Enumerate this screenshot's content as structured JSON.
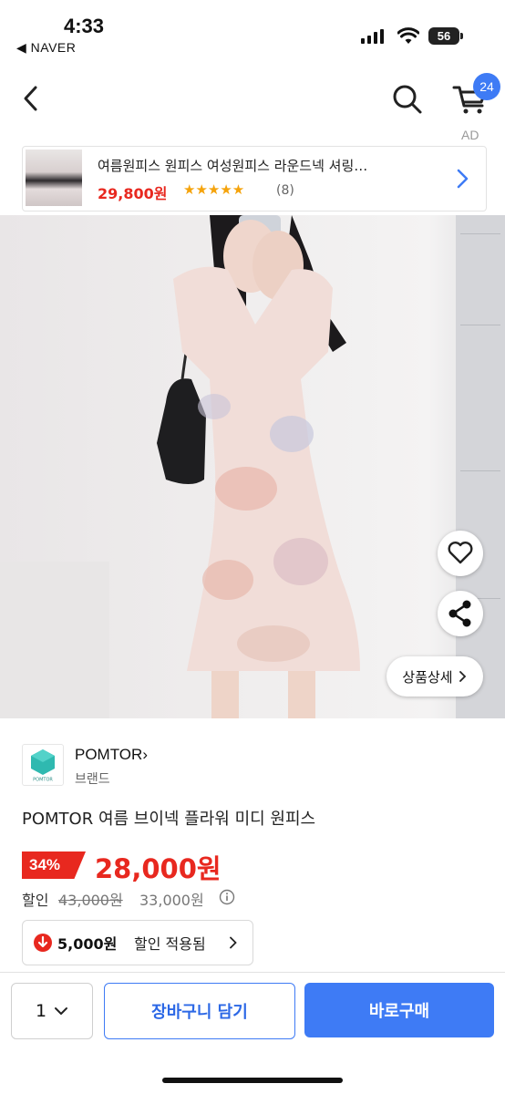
{
  "status_bar": {
    "time": "4:33",
    "back_app": "◀ NAVER",
    "battery": "56"
  },
  "nav": {
    "cart_count": "24",
    "ad_label": "AD"
  },
  "ad_banner": {
    "title": "여름원피스 원피스 여성원피스 라운드넥 셔링…",
    "price": "29,800원",
    "stars": "★★★★★",
    "review_count": "(8)"
  },
  "product_image": {
    "detail_button": "상품상세"
  },
  "brand": {
    "name": "POMTOR",
    "sub": "브랜드",
    "logo_text": "POMTOR"
  },
  "product": {
    "title": "POMTOR 여름 브이넥 플라워 미디 원피스",
    "discount_rate": "34%",
    "sale_price": "28,000원",
    "discount_label": "할인",
    "original_price": "43,000원",
    "alt_price": "33,000원"
  },
  "coupon": {
    "amount": "5,000원",
    "text": "할인 적용됨"
  },
  "bottom_bar": {
    "quantity": "1",
    "cart_button": "장바구니 담기",
    "buy_button": "바로구매"
  },
  "colors": {
    "accent": "#3e7bf5",
    "sale": "#e8281f",
    "star": "#f5a30b"
  }
}
